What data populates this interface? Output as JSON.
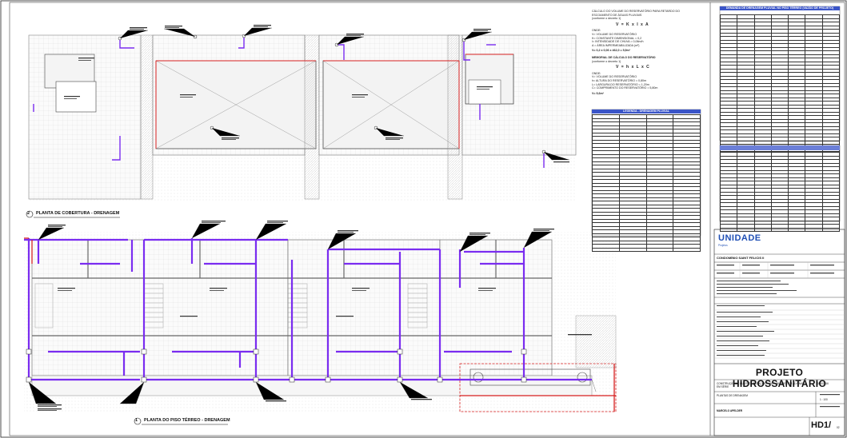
{
  "plans": {
    "roof": {
      "number": "2",
      "title": "PLANTA DE COBERTURA - DRENAGEM"
    },
    "ground": {
      "number": "1",
      "title": "PLANTA DO PISO TÉRREO - DRENAGEM"
    }
  },
  "calc": {
    "title": "CÁLCULO DO VOLUME DO RESERVATÓRIO PARA RETARDO DO ESCOAMENTO DE ÁGUAS PLUVIAIS",
    "ref1": "(conforme o decreto 1)",
    "eq1": "V = K x I x A",
    "onde1": "ONDE:",
    "lines1": [
      "V= VOLUME DO RESERVATÓRIO",
      "K= CONSTANTE DIMENSIONAL = 0,2",
      "I= INTENSIDADE DE CHUVA = 0,06m/h",
      "A = ÁREA IMPERMEABILIZADA (m²)"
    ],
    "result1": "V= 0,2 x 0,06 x 462,0 = 5,5m³",
    "memo_title": "MEMORIAL DE CÁLCULO DO RESERVATÓRIO",
    "ref2": "(conforme o decreto 1)",
    "eq2": "V = h x L x C",
    "onde2": "ONDE:",
    "lines2": [
      "V= VOLUME DO RESERVATÓRIO",
      "h= ALTURA DO RESERVATÓRIO = 0,80m",
      "L= LARGURA DO RESERVATÓRIO = 1,20m",
      "C= COMPRIMENTO DO RESERVATÓRIO = 5,80m"
    ],
    "result2": "V= 5,6m³"
  },
  "demand_table": {
    "title": "DEMANDA DE DRENAGEM PLUVIAL NO PISO TÉRREO (VAZÃO DE PROJETO)"
  },
  "legend_table": {
    "title": "LEGENDA - DRENAGEM PLUVIAL"
  },
  "title_block": {
    "logo": "UNIDADE",
    "logo_sub": "Projetos",
    "project_name": "CONDOMÍNIO SAINT FELICIS II",
    "project_title": "PROJETO HIDROSSANITÁRIO",
    "description": "CONSTRUÇÃO DE QUATRO HABITAÇÕES UNIFAMILIARES EM ALVENARIA EM SÉRIE",
    "drawing_content": "PLANTAS DE DRENAGEM",
    "sheet_number": "HD1/",
    "sheet_total": "02",
    "scale": "1 : 100",
    "date": "12/05/2016",
    "author": "MARCELO APELDER"
  },
  "colors": {
    "pipe": "#7a2cf0",
    "pipe_red": "#d61f1f",
    "wall": "#8a8a8a",
    "hatch": "#cfcfcf",
    "table_blue": "#3b55c8"
  }
}
